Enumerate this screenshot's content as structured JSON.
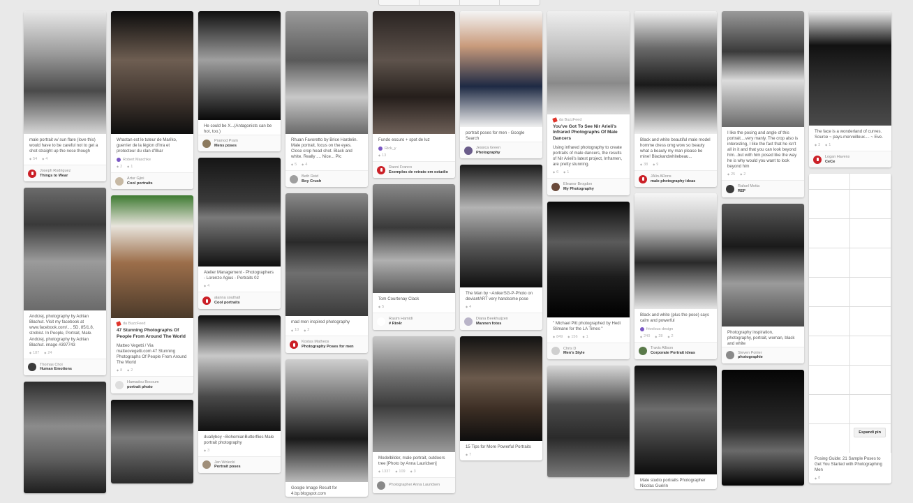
{
  "columns": [
    [
      {
        "h": 176,
        "bg": "linear-gradient(180deg,#e8e8e8 0%,#9a9a9a 35%,#4a4a4a 65%,#d8d8d8 100%)",
        "source": "",
        "title": "",
        "desc": "male portrait w/ sun flare (love this) would have to be careful not to get a shot straight up the nose though",
        "repins": "54",
        "likes": "4",
        "comments": "",
        "avatar": "red",
        "name": "Joseph Rodriguez",
        "board": "Things to Wear"
      },
      {
        "h": 176,
        "bg": "linear-gradient(180deg,#6b6b6b 0%,#3a3a3a 30%,#9b9b9b 60%,#6a6a6a 100%)",
        "source": "",
        "title": "",
        "desc": "Andrzej, photography by Adrian Błachut. Visit my facebook at www.facebook.com/.... 5D, 85/1.8, strobist. In People, Portrait, Male. Andrzej, photography by Adrian Błachut. image #397743",
        "repins": "187",
        "likes": "24",
        "comments": "",
        "avatar": "#3b3b3b",
        "name": "Thomas Choi",
        "board": "Human Emotions"
      },
      {
        "h": 160,
        "bg": "linear-gradient(180deg,#2d2d2d 0%,#8c8c8c 40%,#5e5e5e 70%,#1e1e1e 100%)",
        "source": "",
        "title": "",
        "desc": "",
        "repins": "",
        "likes": "",
        "comments": "",
        "avatar": "",
        "name": "",
        "board": ""
      }
    ],
    [
      {
        "h": 176,
        "bg": "linear-gradient(180deg,#0c0c0c 0%,#6e5e52 40%,#3a302a 75%,#0e0e0e 100%)",
        "source": "",
        "title": "",
        "desc": "Wrastan est le tuteur de Marîko, guerrier de la légion d'Irra et protecteur du clan d'Ilkar",
        "repins": "",
        "likes": "",
        "comments": "",
        "via": "Robert Maschke",
        "avatar": "",
        "name": "",
        "board": ""
      },
      {
        "h": 0,
        "bg": "",
        "source": "",
        "title": "",
        "desc": "",
        "repins": "2",
        "likes": "1",
        "comments": "",
        "avatar": "#c7b9a4",
        "name": "Artur Gjini",
        "board": "Cool portraits",
        "footOnly": true
      },
      {
        "h": 176,
        "bg": "linear-gradient(180deg,#3d7a31 0%,#e8e4dc 25%,#9c6e4a 55%,#4b3a2a 100%)",
        "source": "da BuzzFeed",
        "title": "47 Stunning Photographs Of People From Around The World",
        "desc": "Matteo Vegetti / Via matteovegetti.com 47 Stunning Photographs Of People From Around The World",
        "repins": "8",
        "likes": "2",
        "comments": "",
        "avatar": "#dedede",
        "name": "Hamadou Bocoum",
        "board": "portrait photo"
      },
      {
        "h": 120,
        "bg": "linear-gradient(180deg,#111 0%,#7a7a7a 45%,#2b2b2b 100%)",
        "source": "",
        "title": "",
        "desc": "",
        "repins": "",
        "likes": "",
        "comments": "",
        "avatar": "",
        "name": "",
        "board": ""
      }
    ],
    [
      {
        "h": 156,
        "bg": "linear-gradient(180deg,#0f0f0f 0%,#9f9f9f 45%,#5a5a5a 70%,#0a0a0a 100%)",
        "source": "",
        "title": "",
        "desc": "He could be X...(Antagonists can be hot, too.)",
        "repins": "",
        "likes": "",
        "comments": "",
        "avatar": "#8c7a5e",
        "name": "Pramod Pram",
        "board": "Mens poses"
      },
      {
        "h": 156,
        "bg": "linear-gradient(180deg,#151515 0%,#3a3a3a 40%,#7a7a7a 55%,#111 100%)",
        "source": "",
        "title": "",
        "desc": "Atelier Management - Photographers - Lorenzo Agius - Portraits 02",
        "repins": "4",
        "likes": "",
        "comments": "",
        "avatar": "red",
        "name": "alanna southall",
        "board": "Cool portraits"
      },
      {
        "h": 166,
        "bg": "linear-gradient(180deg,#0c0c0c 0%,#c8c8c8 35%,#4a4a4a 70%,#111 100%)",
        "source": "",
        "title": "",
        "desc": "duallyboy ~BohemianButterflies Male portrait photography",
        "repins": "3",
        "likes": "",
        "comments": "",
        "avatar": "#a08f7a",
        "name": "Jan Wolecki",
        "board": "Portrait poses"
      }
    ],
    [
      {
        "h": 176,
        "bg": "linear-gradient(180deg,#9a9a9a 0%,#5a5a5a 40%,#c8c8c8 70%,#6a6a6a 100%)",
        "source": "",
        "title": "",
        "desc": "Rhuan Favoretto by Brice Hardelin. Male portrait, focus on the eyes. Close crop head shot. Black and white. Really .... Nice... Pic",
        "repins": "5",
        "likes": "4",
        "comments": "",
        "avatar": "#9e9e9e",
        "name": "Beth Reid",
        "board": "Boy Crush"
      },
      {
        "h": 176,
        "bg": "linear-gradient(180deg,#8a8a8a 0%,#2a2a2a 40%,#6f6f6f 65%,#3a3a3a 100%)",
        "source": "",
        "title": "",
        "desc": "mad men inspired photography",
        "repins": "10",
        "likes": "2",
        "comments": "",
        "avatar": "red",
        "name": "Kostas Matheos",
        "board": "Photography Poses for men"
      },
      {
        "h": 176,
        "bg": "linear-gradient(180deg,#cfcfcf 0%,#6d6d6d 35%,#1a1a1a 65%,#bbb 100%)",
        "source": "",
        "title": "",
        "desc": "Google Image Result for 4.bp.blogspot.com",
        "repins": "",
        "likes": "",
        "comments": "",
        "avatar": "",
        "name": "",
        "board": ""
      }
    ],
    [
      {
        "h": 176,
        "bg": "linear-gradient(180deg,#2a2422 0%,#5e534c 40%,#251e1b 70%,#6e6058 100%)",
        "source": "",
        "title": "",
        "desc": "Fundo escuro + spot de luz",
        "repins": "",
        "likes": "",
        "comments": "",
        "via": "Rick_y",
        "repinsTop": "13",
        "avatar": "red",
        "name": "Raoni Franco",
        "board": "Exemplos de retrato em estudio"
      },
      {
        "h": 156,
        "bg": "linear-gradient(180deg,#8a8a8a 0%,#3a3a3a 40%,#b0b0b0 70%,#5a5a5a 100%)",
        "source": "",
        "title": "",
        "desc": "Tom Courtenay Clack",
        "repins": "5",
        "likes": "",
        "comments": "",
        "avatar": "#fff",
        "name": "Rasim Hamidi",
        "board": "# Rin4r"
      },
      {
        "h": 166,
        "bg": "linear-gradient(180deg,#c8c8c8 0%,#6e6e6e 35%,#3b3b3b 60%,#9a9a9a 100%)",
        "source": "",
        "title": "",
        "desc": "Modelbilder, male portrait, outdoors tree [Photo by Anna Lauridsen]",
        "repins": "1337",
        "likes": "109",
        "comments": "3",
        "avatar": "#888",
        "name": "Photographer Anna Lauridsen",
        "board": ""
      }
    ],
    [
      {
        "h": 166,
        "bg": "linear-gradient(180deg,#f4f4f4 0%,#c99b7c 30%,#1e2a44 65%,#f0f0f0 100%)",
        "source": "",
        "title": "",
        "desc": "portrait poses for men - Google Search",
        "repins": "",
        "likes": "",
        "comments": "",
        "avatar": "#6a5c8a",
        "name": "Jessica Green",
        "board": "Photography"
      },
      {
        "h": 176,
        "bg": "linear-gradient(180deg,#1a1a1a 0%,#b3b3b3 35%,#5a5a5a 65%,#0f0f0f 100%)",
        "source": "",
        "title": "",
        "desc": "The Man by ~AnikerSG-P-Photo on deviantART very handsome pose",
        "repins": "4",
        "likes": "",
        "comments": "",
        "avatar": "#b9b4c8",
        "name": "Diana Beekhuijzen",
        "board": "Mannen fotos"
      },
      {
        "h": 150,
        "bg": "linear-gradient(180deg,#111 0%,#6b5a4c 40%,#3c2e24 70%,#0e0e0e 100%)",
        "source": "",
        "title": "",
        "desc": "15 Tips for More Powerful Portraits",
        "repins": "7",
        "likes": "",
        "comments": "",
        "avatar": "",
        "name": "",
        "board": ""
      }
    ],
    [
      {
        "h": 148,
        "bg": "linear-gradient(180deg,#efefef 0%,#bdbdbd 40%,#8a8a8a 70%,#dadada 100%)",
        "source": "da BuzzFeed",
        "title": "You've Got To See Nir Arieli's Infrared Photographs Of Male Dancers",
        "desc": "Using infrared photography to create portraits of male dancers, the results of Nir Arieli's latest project, Inframen, are pretty stunning.",
        "repins": "6",
        "likes": "1",
        "comments": "",
        "avatar": "#6a4a3a",
        "name": "Eleanor Brogdon",
        "board": "My Photography"
      },
      {
        "h": 166,
        "bg": "linear-gradient(180deg,#0a0a0a 0%,#5b5b5b 35%,#1c1c1c 65%,#000 100%)",
        "source": "",
        "title": "",
        "desc": "\" Michael Pitt photographed by Hedi Slimane for the LA Times \"",
        "repins": "849",
        "likes": "156",
        "comments": "1",
        "avatar": "#cfcfcf",
        "name": "Chris D",
        "board": "Men's Style"
      },
      {
        "h": 160,
        "bg": "linear-gradient(180deg,#d8d8d8 0%,#4b4b4b 35%,#2a2a2a 65%,#7a7a7a 100%)",
        "source": "",
        "title": "",
        "desc": "",
        "repins": "",
        "likes": "",
        "comments": "",
        "avatar": "",
        "name": "",
        "board": ""
      }
    ],
    [
      {
        "h": 176,
        "bg": "linear-gradient(180deg,#f2f2f2 0%,#6a6a6a 30%,#1a1a1a 60%,#ececec 100%)",
        "source": "",
        "title": "",
        "desc": "Black and white beautiful male model homme dress omg wow so beauty what a beauty my man please be mine! Blackandwhitebeau...",
        "repins": "38",
        "likes": "9",
        "comments": "",
        "avatar": "red",
        "name": "JAlin ARons",
        "board": "male photography ideas"
      },
      {
        "h": 166,
        "bg": "linear-gradient(180deg,#f6f6f6 0%,#bcbcbc 30%,#2a2a2a 60%,#e5e5e5 100%)",
        "source": "",
        "title": "",
        "desc": "Black and white (plus the pose) says calm and powerful",
        "repins": "240",
        "likes": "28",
        "comments": "2",
        "via": "frivolous design",
        "avatar": "#5a7a4a",
        "name": "Travis Allison",
        "board": "Corporate Portrait ideas"
      },
      {
        "h": 156,
        "bg": "linear-gradient(180deg,#111 0%,#6c6c6c 40%,#3a3a3a 70%,#0d0d0d 100%)",
        "source": "",
        "title": "",
        "desc": "Male studio portraits Photographer Nicolas Guérin",
        "repins": "",
        "likes": "",
        "comments": "",
        "avatar": "",
        "name": "",
        "board": ""
      }
    ],
    [
      {
        "h": 166,
        "bg": "linear-gradient(180deg,#9a9a9a 0%,#3a3a3a 35%,#dcdcdc 60%,#6a6a6a 100%)",
        "source": "",
        "title": "",
        "desc": "I like the posing and angle of this portrait....very manly. The crop also is interesting, I like the fact that he isn't all in it and that you can look beyond him...but with him posed like the way he is why would you want to look beyond him",
        "repins": "25",
        "likes": "2",
        "comments": "",
        "avatar": "#3a3a3a",
        "name": "Rafael Motta",
        "board": "REF"
      },
      {
        "h": 176,
        "bg": "linear-gradient(180deg,#5a5a5a 0%,#1a1a1a 35%,#9b9b9b 65%,#4a4a4a 100%)",
        "source": "",
        "title": "",
        "desc": "Photography inspiration, photography, portrait, woman, black and white",
        "repins": "",
        "likes": "",
        "comments": "",
        "avatar": "#8a8a8a",
        "name": "Steven Poirier",
        "board": "photographie"
      },
      {
        "h": 166,
        "bg": "linear-gradient(180deg,#050505 0%,#2a2a2a 50%,#6a6a6a 70%,#050505 100%)",
        "source": "",
        "title": "",
        "desc": "",
        "repins": "",
        "likes": "",
        "comments": "",
        "avatar": "",
        "name": "",
        "board": ""
      }
    ],
    [
      {
        "h": 164,
        "bg": "linear-gradient(180deg,#ededed 0%,#111 30%,#2e2e2e 60%,#4a4a4a 100%)",
        "source": "",
        "title": "",
        "desc": "The face is a wonderland of curves. Source ~ pays-merveilleux.... ~ Eve.",
        "repins": "3",
        "likes": "1",
        "comments": "",
        "avatar": "red",
        "name": "Logan Havens",
        "board": "CeCe"
      },
      {
        "h": 400,
        "bg": "sketch",
        "source": "",
        "title": "",
        "desc": "Posing Guide: 21 Sample Poses to Get You Started with Photographing Men",
        "repins": "8",
        "likes": "",
        "comments": "",
        "expand": "Espandi pin",
        "avatar": "",
        "name": "",
        "board": ""
      }
    ]
  ],
  "col_lefts": [
    34,
    159,
    284,
    409,
    534,
    659,
    784,
    909,
    1034,
    1159
  ]
}
